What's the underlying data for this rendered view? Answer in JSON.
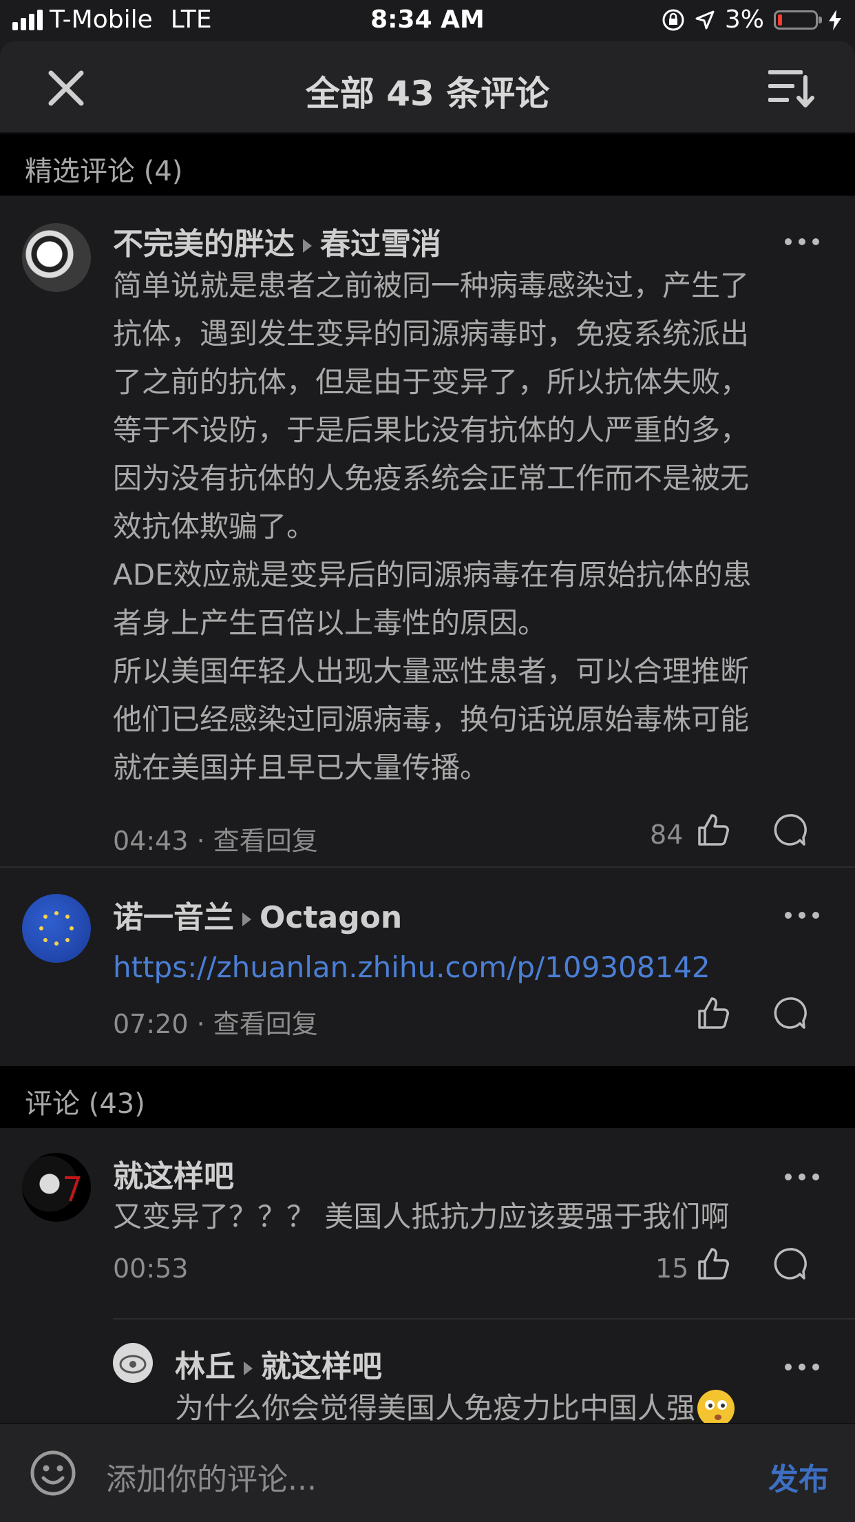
{
  "status": {
    "carrier": "T-Mobile",
    "network": "LTE",
    "time": "8:34 AM",
    "battery": "3%"
  },
  "header": {
    "title": "全部 43 条评论"
  },
  "featured": {
    "label": "精选评论 (4)"
  },
  "all": {
    "label": "评论 (43)"
  },
  "comments": [
    {
      "author": "不完美的胖达",
      "reply_to": "春过雪消",
      "lines": [
        "简单说就是患者之前被同一种病毒感染过，产生了",
        "抗体，遇到发生变异的同源病毒时，免疫系统派出",
        "了之前的抗体，但是由于变异了，所以抗体失败，",
        "等于不设防，于是后果比没有抗体的人严重的多，",
        "因为没有抗体的人免疫系统会正常工作而不是被无",
        "效抗体欺骗了。",
        "ADE效应就是变异后的同源病毒在有原始抗体的患",
        "者身上产生百倍以上毒性的原因。",
        "所以美国年轻人出现大量恶性患者，可以合理推断",
        "他们已经感染过同源病毒，换句话说原始毒株可能",
        "就在美国并且早已大量传播。"
      ],
      "time": "04:43",
      "view_replies": "查看回复",
      "likes": "84"
    },
    {
      "author": "诺一音兰",
      "reply_to": "Octagon",
      "link": "https://zhuanlan.zhihu.com/p/109308142",
      "time": "07:20",
      "view_replies": "查看回复"
    },
    {
      "author": "就这样吧",
      "text": "又变异了？？？ 美国人抵抗力应该要强于我们啊",
      "time": "00:53",
      "likes": "15"
    },
    {
      "author": "林丘",
      "reply_to": "就这样吧",
      "text": "为什么你会觉得美国人免疫力比中国人强"
    }
  ],
  "input": {
    "placeholder": "添加你的评论...",
    "publish": "发布"
  },
  "colors": {
    "accent": "#4b7fd6",
    "background": "#1b1b1d",
    "section": "#000000"
  }
}
